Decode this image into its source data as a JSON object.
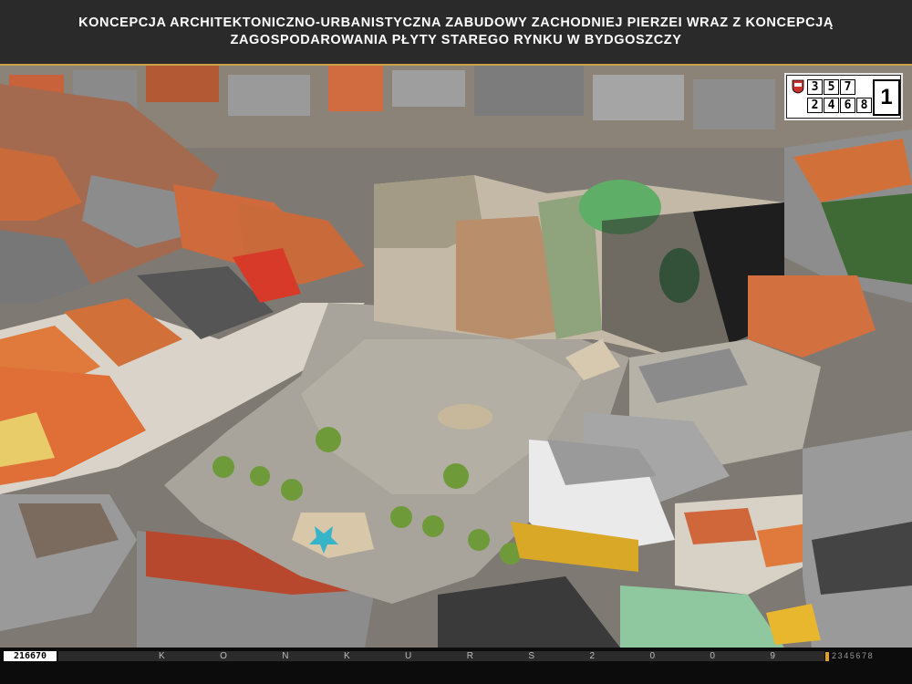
{
  "title": {
    "line1": "KONCEPCJA ARCHITEKTONICZNO-URBANISTYCZNA ZABUDOWY ZACHODNIEJ PIERZEI WRAZ Z KONCEPCJĄ",
    "line2": "ZAGOSPODAROWANIA PŁYTY STAREGO RYNKU W BYDGOSZCZY"
  },
  "sheet_code": {
    "digits": [
      "3",
      "5",
      "7",
      "",
      "2",
      "4",
      "6",
      "8"
    ],
    "sheet_number": "1"
  },
  "footer": {
    "entry_id": "216670",
    "competition_letters": [
      "K",
      "O",
      "N",
      "K",
      "U",
      "R",
      "S",
      "2",
      "0",
      "0",
      "9"
    ],
    "page_numbers": "2345678"
  },
  "photo": {
    "content": "aerial view of old market square with surrounding buildings"
  }
}
